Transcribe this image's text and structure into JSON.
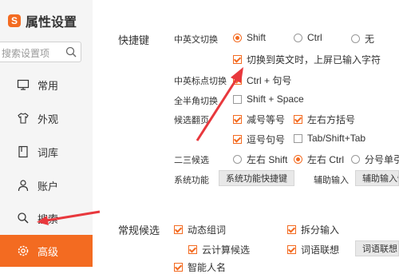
{
  "sidebar": {
    "title": "属性设置",
    "logo_char": "S",
    "search_placeholder": "搜索设置项",
    "items": [
      {
        "label": "常用",
        "icon": "monitor-icon"
      },
      {
        "label": "外观",
        "icon": "shirt-icon"
      },
      {
        "label": "词库",
        "icon": "book-icon"
      },
      {
        "label": "账户",
        "icon": "person-icon"
      },
      {
        "label": "搜索",
        "icon": "search-icon"
      },
      {
        "label": "高级",
        "icon": "gear-icon",
        "active": true
      }
    ]
  },
  "shortcuts": {
    "section_title": "快捷键",
    "cn_en_switch": {
      "label": "中英文切换",
      "options": [
        {
          "label": "Shift",
          "selected": true
        },
        {
          "label": "Ctrl",
          "selected": false
        },
        {
          "label": "无",
          "selected": false
        }
      ],
      "commit_on_switch": {
        "label": "切换到英文时，上屏已输入字符",
        "checked": true
      }
    },
    "punct_switch": {
      "label": "中英标点切换",
      "option": {
        "label": "Ctrl + 句号",
        "checked": true
      }
    },
    "width_switch": {
      "label": "全半角切换",
      "option": {
        "label": "Shift + Space",
        "checked": false
      }
    },
    "paging": {
      "label": "候选翻页",
      "options": [
        {
          "label": "减号等号",
          "checked": true
        },
        {
          "label": "左右方括号",
          "checked": true
        },
        {
          "label": "逗号句号",
          "checked": true
        },
        {
          "label": "Tab/Shift+Tab",
          "checked": false
        }
      ]
    },
    "second_third": {
      "label": "二三候选",
      "options": [
        {
          "label": "左右 Shift",
          "selected": false
        },
        {
          "label": "左右 Ctrl",
          "selected": true
        },
        {
          "label": "分号单引",
          "selected": false
        }
      ]
    },
    "system": {
      "label": "系统功能",
      "button": "系统功能快捷键",
      "aux_label": "辅助输入",
      "aux_button": "辅助输入快"
    }
  },
  "candidates": {
    "section_title": "常规候选",
    "options": [
      {
        "label": "动态组词",
        "checked": true
      },
      {
        "label": "拆分输入",
        "checked": true
      },
      {
        "label": "云计算候选",
        "checked": true
      },
      {
        "label": "词语联想",
        "checked": true
      },
      {
        "label": "智能人名",
        "checked": true
      }
    ],
    "button": "词语联想"
  },
  "colors": {
    "accent": "#f36b21",
    "annotation_arrow": "#e8383d"
  }
}
